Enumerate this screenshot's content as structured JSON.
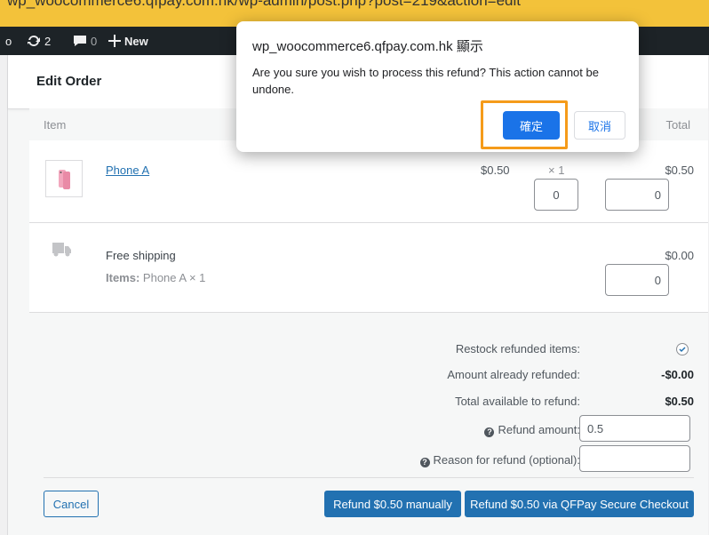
{
  "browser": {
    "url": "wp_woocommerce6.qfpay.com.hk/wp-admin/post.php?post=219&action=edit"
  },
  "adminbar": {
    "left_glyph": "o",
    "updates_count": "2",
    "comments_count": "0",
    "new_label": "New"
  },
  "header": {
    "title": "Edit Order"
  },
  "columns": {
    "item": "Item",
    "total": "Total"
  },
  "items": [
    {
      "name": "Phone A",
      "cost": "$0.50",
      "qty": "× 1",
      "line_total": "$0.50",
      "refund_qty": "0",
      "refund_total": "0"
    }
  ],
  "shipping": {
    "name": "Free shipping",
    "items_label": "Items:",
    "items_value": "Phone A × 1",
    "total": "$0.00",
    "refund_total": "0"
  },
  "refund": {
    "restock_label": "Restock refunded items:",
    "already_label": "Amount already refunded:",
    "already_value": "-$0.00",
    "available_label": "Total available to refund:",
    "available_value": "$0.50",
    "amount_label": "Refund amount:",
    "amount_value": "0.5",
    "reason_label": "Reason for refund (optional):",
    "reason_value": "",
    "cancel_label": "Cancel",
    "manual_label": "Refund $0.50 manually",
    "gateway_label": "Refund $0.50 via QFPay Secure Checkout"
  },
  "dialog": {
    "title": "wp_woocommerce6.qfpay.com.hk 顯示",
    "message": "Are you sure you wish to process this refund? This action cannot be undone.",
    "ok_label": "確定",
    "cancel_label": "取消"
  },
  "colors": {
    "accent": "#2271b1",
    "dialog_button": "#1a73e8",
    "highlight": "#f59b1a",
    "adminbar": "#1d2327"
  }
}
